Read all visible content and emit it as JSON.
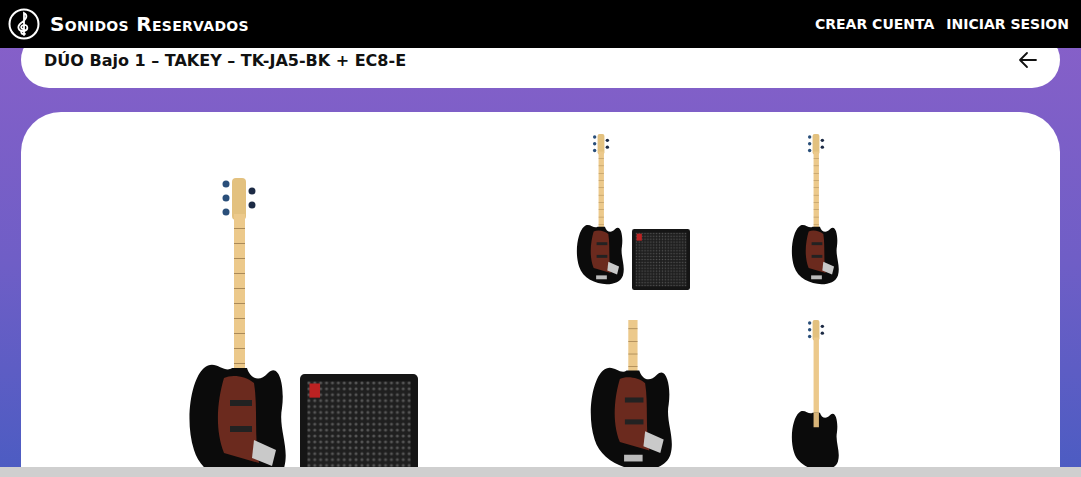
{
  "header": {
    "logo_text": "Sonidos Reservados",
    "nav": [
      "CREAR CUENTA",
      "INICIAR SESION"
    ]
  },
  "product": {
    "title": "DÚO Bajo 1 – TAKEY – TK-JA5-BK + EC8-E"
  },
  "gallery": {
    "main": {
      "kind": "bass-amp"
    },
    "thumbnails": [
      {
        "kind": "bass-amp"
      },
      {
        "kind": "bass"
      },
      {
        "kind": "body"
      },
      {
        "kind": "back"
      }
    ]
  }
}
